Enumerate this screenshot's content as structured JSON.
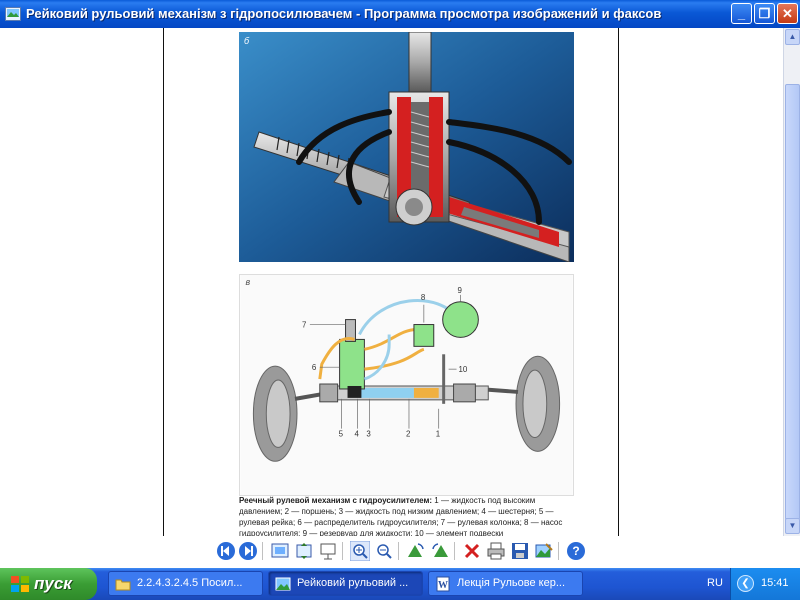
{
  "window": {
    "title": "Рейковий рульовий механізм з гідропосилювачем - Программа просмотра изображений и факсов",
    "buttons": {
      "minimize": "_",
      "maximize": "❐",
      "close": "✕"
    }
  },
  "document": {
    "photo_label": "б",
    "scheme_label": "в",
    "scheme_numbers": [
      "1",
      "2",
      "3",
      "4",
      "5",
      "6",
      "7",
      "8",
      "9",
      "10"
    ],
    "caption_title": "Реечный рулевой механизм с гидроусилителем:",
    "caption_body": "1 — жидкость под высоким давлением; 2 — поршень; 3 — жидкость под низким давлением; 4 — шестерня; 5 — рулевая рейка; 6 — распределитель гидроусилителя; 7 — рулевая колонка; 8 — насос гидроусилителя; 9 — резервуар для жидкости; 10 — элемент подвески"
  },
  "toolbar": {
    "icons": [
      "previous-image-icon",
      "next-image-icon",
      "best-fit-icon",
      "actual-size-icon",
      "slideshow-icon",
      "zoom-in-icon",
      "zoom-out-icon",
      "rotate-clockwise-icon",
      "rotate-counterclockwise-icon",
      "delete-icon",
      "print-icon",
      "save-icon",
      "open-editor-icon",
      "help-icon"
    ]
  },
  "taskbar": {
    "start_label": "пуск",
    "tasks": [
      {
        "label": "2.2.4.3.2.4.5 Посил...",
        "icon": "folder-icon"
      },
      {
        "label": "Рейковий рульовий ...",
        "icon": "image-viewer-icon"
      },
      {
        "label": "Лекція Рульове кер...",
        "icon": "word-document-icon"
      }
    ],
    "language": "RU",
    "clock": "15:41"
  },
  "colors": {
    "titlebar": "#0a58d6",
    "taskbar": "#245edb",
    "start": "#3a9d34",
    "photo_bg": "#1f5f9c",
    "pump_green": "#8ee28a",
    "fluid_yellow": "#f0b040",
    "pipe_blue": "#9bd0ea"
  }
}
